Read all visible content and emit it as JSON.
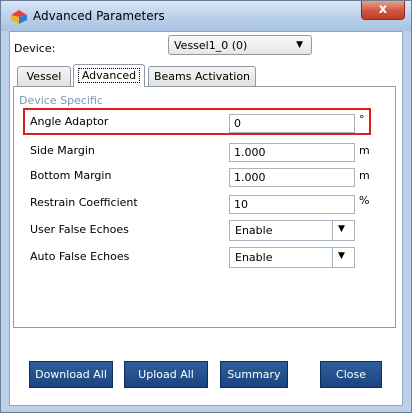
{
  "window": {
    "title": "Advanced Parameters",
    "close_glyph": "x"
  },
  "device": {
    "label": "Device:",
    "value": "Vessel1_0 (0)"
  },
  "tabs": [
    {
      "label": "Vessel",
      "active": false
    },
    {
      "label": "Advanced",
      "active": true
    },
    {
      "label": "Beams Activation",
      "active": false
    }
  ],
  "group": {
    "title": "Device Specific"
  },
  "rows": [
    {
      "label": "Angle Adaptor",
      "value": "0",
      "unit": "°"
    },
    {
      "label": "Side Margin",
      "value": "1.000",
      "unit": "m"
    },
    {
      "label": "Bottom Margin",
      "value": "1.000",
      "unit": "m"
    },
    {
      "label": "Restrain Coefficient",
      "value": "10",
      "unit": "%"
    },
    {
      "label": "User False Echoes",
      "value": "Enable",
      "options_visible": [
        "Enable"
      ]
    },
    {
      "label": "Auto False Echoes",
      "value": "Enable",
      "options_visible": [
        "Enable"
      ]
    }
  ],
  "buttons": {
    "download_all": "Download All",
    "upload_all": "Upload All",
    "summary": "Summary",
    "close": "Close"
  },
  "colors": {
    "highlight": "#e01b1b",
    "button_bg": "#1f4a86",
    "group_title": "#8096b3"
  },
  "icons": {
    "app": "app-logo-icon",
    "dropdown": "chevron-down-icon",
    "close": "close-icon"
  }
}
